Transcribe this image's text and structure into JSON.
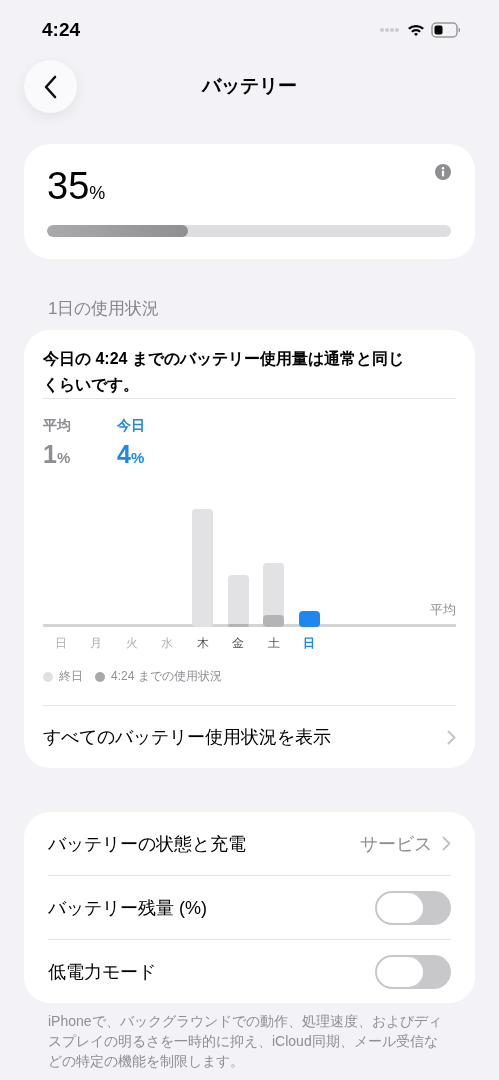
{
  "status_bar": {
    "time": "4:24"
  },
  "nav": {
    "title": "バッテリー"
  },
  "battery": {
    "percent": "35",
    "unit": "%",
    "level": 0.35
  },
  "section_header": "1日の使用状況",
  "usage": {
    "summary": "今日の 4:24 までのバッテリー使用量は通常と同じくらいです。",
    "stats": [
      {
        "label": "平均",
        "value": "1",
        "unit": "%",
        "selected": false
      },
      {
        "label": "今日",
        "value": "4",
        "unit": "%",
        "selected": true
      }
    ],
    "average_label": "平均",
    "days": [
      {
        "label": "日",
        "selected": false
      },
      {
        "label": "月",
        "selected": false
      },
      {
        "label": "火",
        "selected": false
      },
      {
        "label": "水",
        "selected": false
      },
      {
        "label": "木",
        "selected": false
      },
      {
        "label": "金",
        "selected": false
      },
      {
        "label": "土",
        "selected": false
      },
      {
        "label": "日",
        "selected": true
      }
    ],
    "legend": [
      {
        "label": "終日",
        "color": "#e0e0e0"
      },
      {
        "label": "4:24 までの使用状況",
        "color": "#a8a8a8"
      }
    ],
    "link": "すべてのバッテリー使用状況を表示"
  },
  "settings": [
    {
      "kind": "link",
      "label": "バッテリーの状態と充電",
      "value": "サービス"
    },
    {
      "kind": "toggle",
      "label": "バッテリー残量 (%)",
      "on": false
    },
    {
      "kind": "toggle",
      "label": "低電力モード",
      "on": false
    }
  ],
  "footer": "iPhoneで、バックグラウンドでの動作、処理速度、およびディスプレイの明るさを一時的に抑え、iCloud同期、メール受信などの特定の機能を制限します。"
}
